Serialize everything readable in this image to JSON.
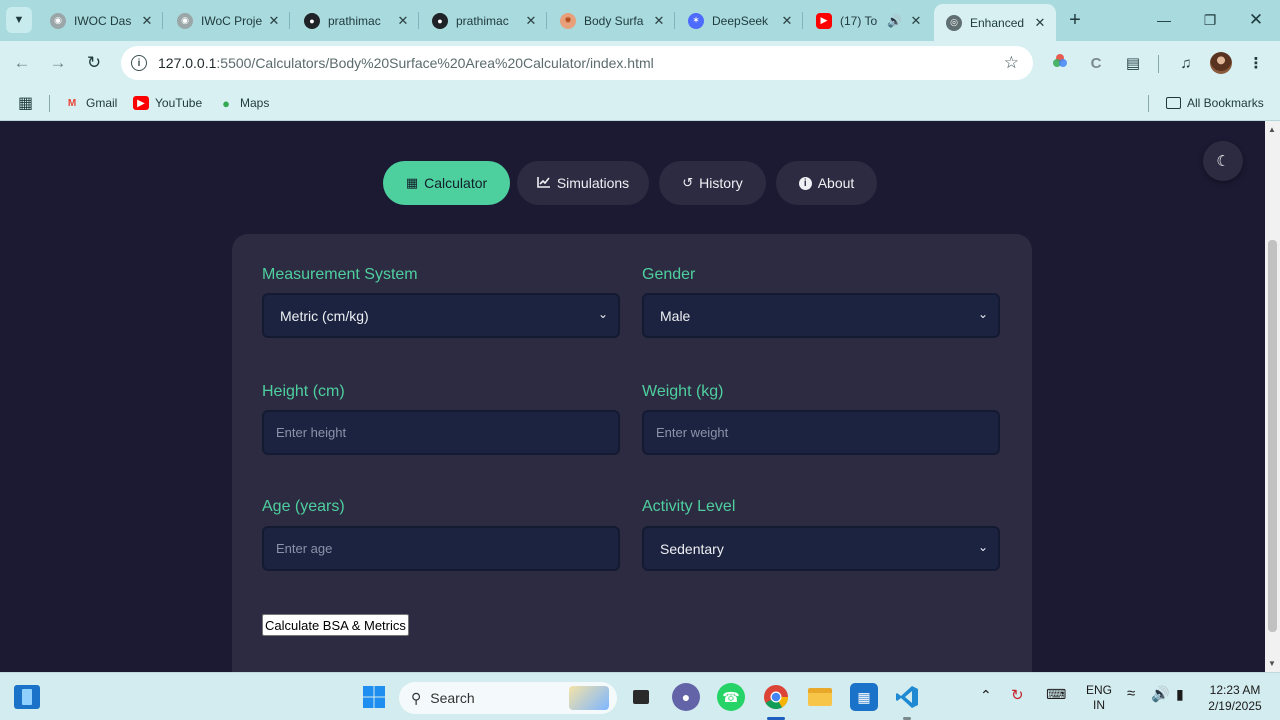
{
  "browser": {
    "tabs": [
      {
        "title": "IWOC Das",
        "favicon": "iwoc-icon",
        "active": false
      },
      {
        "title": "IWoC Proje",
        "favicon": "iwoc-icon",
        "active": false
      },
      {
        "title": "prathimac",
        "favicon": "github-icon",
        "active": false
      },
      {
        "title": "prathimac",
        "favicon": "github-icon",
        "active": false
      },
      {
        "title": "Body Surfa",
        "favicon": "sun-icon",
        "active": false
      },
      {
        "title": "DeepSeek",
        "favicon": "deepseek-icon",
        "active": false
      },
      {
        "title": "(17) To",
        "favicon": "youtube-icon",
        "active": false
      },
      {
        "title": "Enhanced",
        "favicon": "globe-icon",
        "active": true
      }
    ],
    "url_host": "127.0.0.1",
    "url_path": ":5500/Calculators/Body%20Surface%20Area%20Calculator/index.html",
    "bookmarks": [
      {
        "label": "Gmail",
        "icon": "gmail-icon"
      },
      {
        "label": "YouTube",
        "icon": "youtube-icon"
      },
      {
        "label": "Maps",
        "icon": "maps-icon"
      }
    ],
    "all_bookmarks_label": "All Bookmarks"
  },
  "app": {
    "nav": [
      {
        "label": "Calculator",
        "icon": "calculator-icon",
        "active": true
      },
      {
        "label": "Simulations",
        "icon": "chart-line-icon",
        "active": false
      },
      {
        "label": "History",
        "icon": "history-icon",
        "active": false
      },
      {
        "label": "About",
        "icon": "info-icon",
        "active": false
      }
    ],
    "theme_toggle_icon": "moon-icon",
    "form": {
      "measurement_label": "Measurement System",
      "measurement_value": "Metric (cm/kg)",
      "gender_label": "Gender",
      "gender_value": "Male",
      "height_label": "Height (cm)",
      "height_placeholder": "Enter height",
      "weight_label": "Weight (kg)",
      "weight_placeholder": "Enter weight",
      "age_label": "Age (years)",
      "age_placeholder": "Enter age",
      "activity_label": "Activity Level",
      "activity_value": "Sedentary",
      "submit_label": "Calculate BSA & Metrics"
    }
  },
  "taskbar": {
    "search_label": "Search",
    "language_line1": "ENG",
    "language_line2": "IN",
    "time": "12:23 AM",
    "date": "2/19/2025"
  },
  "colors": {
    "accent": "#4ecf9e",
    "page_bg": "#1c1a33",
    "card_bg": "#2d2b42",
    "input_bg": "#1c2340",
    "chrome_bg": "#a9dadd"
  }
}
